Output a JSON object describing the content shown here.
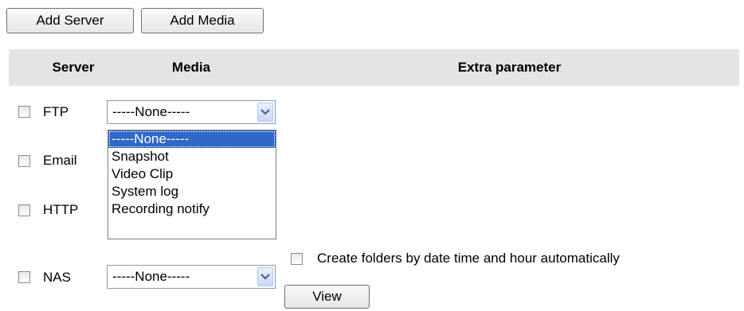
{
  "toolbar": {
    "add_server_label": "Add Server",
    "add_media_label": "Add Media"
  },
  "table_headers": {
    "server": "Server",
    "media": "Media",
    "extra": "Extra parameter"
  },
  "servers": [
    {
      "name": "FTP",
      "checked": false,
      "media_value": "-----None-----"
    },
    {
      "name": "Email",
      "checked": false
    },
    {
      "name": "HTTP",
      "checked": false
    },
    {
      "name": "NAS",
      "checked": false,
      "media_value": "-----None-----"
    }
  ],
  "media_dropdown": {
    "options": [
      "-----None-----",
      "Snapshot",
      "Video Clip",
      "System log",
      "Recording notify"
    ],
    "selected_index": 0
  },
  "nas_extra": {
    "create_folders_label": "Create folders by date time and hour automatically",
    "create_folders_checked": false,
    "view_label": "View"
  },
  "colors": {
    "header_bg": "#e4e4e4",
    "selection": "#3167c6",
    "select_border": "#7f9db9"
  }
}
